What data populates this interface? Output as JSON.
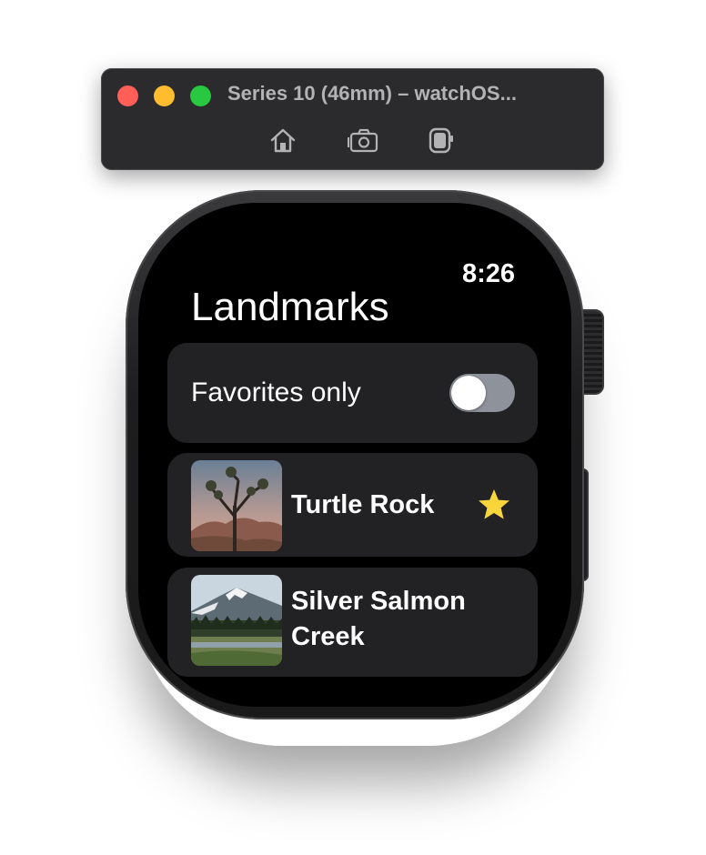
{
  "window": {
    "title": "Series 10 (46mm) – watchOS...",
    "toolbar": [
      {
        "icon": "home-icon"
      },
      {
        "icon": "screenshot-icon"
      },
      {
        "icon": "rotate-icon"
      }
    ]
  },
  "watch": {
    "time": "8:26",
    "title": "Landmarks",
    "favorites_toggle": {
      "label": "Favorites only",
      "on": false
    },
    "landmarks": [
      {
        "name": "Turtle Rock",
        "favorite": true,
        "thumbnail": "joshua-tree-photo"
      },
      {
        "name": "Silver Salmon Creek",
        "favorite": false,
        "thumbnail": "mountain-meadow-photo"
      }
    ]
  },
  "colors": {
    "star": "#f7d53b",
    "switch_off": "#8e939b",
    "cell_bg": "#222224"
  }
}
